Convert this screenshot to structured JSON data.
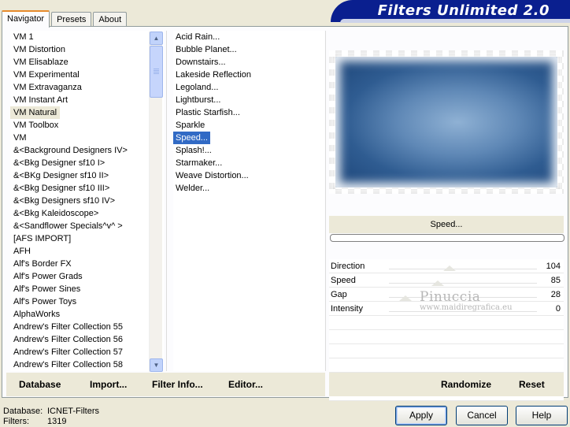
{
  "tabs": [
    {
      "label": "Navigator",
      "active": true
    },
    {
      "label": "Presets",
      "active": false
    },
    {
      "label": "About",
      "active": false
    }
  ],
  "banner": {
    "title": "Filters Unlimited 2.0"
  },
  "categories": {
    "items": [
      "VM 1",
      "VM Distortion",
      "VM Elisablaze",
      "VM Experimental",
      "VM Extravaganza",
      "VM Instant Art",
      "VM Natural",
      "VM Toolbox",
      "VM",
      "&<Background Designers IV>",
      "&<Bkg Designer sf10 I>",
      "&<BKg Designer sf10 II>",
      "&<Bkg Designer sf10 III>",
      "&<Bkg Designers sf10 IV>",
      "&<Bkg Kaleidoscope>",
      "&<Sandflower Specials^v^ >",
      "[AFS IMPORT]",
      "AFH",
      "Alf's Border FX",
      "Alf's Power Grads",
      "Alf's Power Sines",
      "Alf's Power Toys",
      "AlphaWorks",
      "Andrew's Filter Collection 55",
      "Andrew's Filter Collection 56",
      "Andrew's Filter Collection 57",
      "Andrew's Filter Collection 58"
    ],
    "selected": "VM Natural"
  },
  "filters": {
    "items": [
      "Acid Rain...",
      "Bubble Planet...",
      "Downstairs...",
      "Lakeside Reflection",
      "Legoland...",
      "Lightburst...",
      "Plastic Starfish...",
      "Sparkle",
      "Speed...",
      "Splash!...",
      "Starmaker...",
      "Weave Distortion...",
      "Welder..."
    ],
    "selected": "Speed..."
  },
  "preview": {
    "filter_name": "Speed..."
  },
  "params": [
    {
      "label": "Direction",
      "value": "104",
      "level": 0.41
    },
    {
      "label": "Speed",
      "value": "85",
      "level": 0.33
    },
    {
      "label": "Gap",
      "value": "28",
      "level": 0.11
    },
    {
      "label": "Intensity",
      "value": "0",
      "level": 0.0
    }
  ],
  "watermark": {
    "line1": "Pinuccia",
    "line2": "www.maidiregrafica.eu"
  },
  "bottom_left": {
    "database": "Database",
    "import": "Import...",
    "filter_info": "Filter Info...",
    "editor": "Editor..."
  },
  "bottom_right": {
    "randomize": "Randomize",
    "reset": "Reset"
  },
  "footer": {
    "database_label": "Database:",
    "database_value": "ICNET-Filters",
    "filters_label": "Filters:",
    "filters_value": "1319"
  },
  "buttons": {
    "apply": "Apply",
    "cancel": "Cancel",
    "help": "Help"
  },
  "colors": {
    "banner": "#0a1f8f",
    "selection": "#316ac5",
    "tab_accent": "#e68b2c"
  },
  "icons": {
    "scroll_up": "chevron-up-icon",
    "scroll_down": "chevron-down-icon"
  }
}
